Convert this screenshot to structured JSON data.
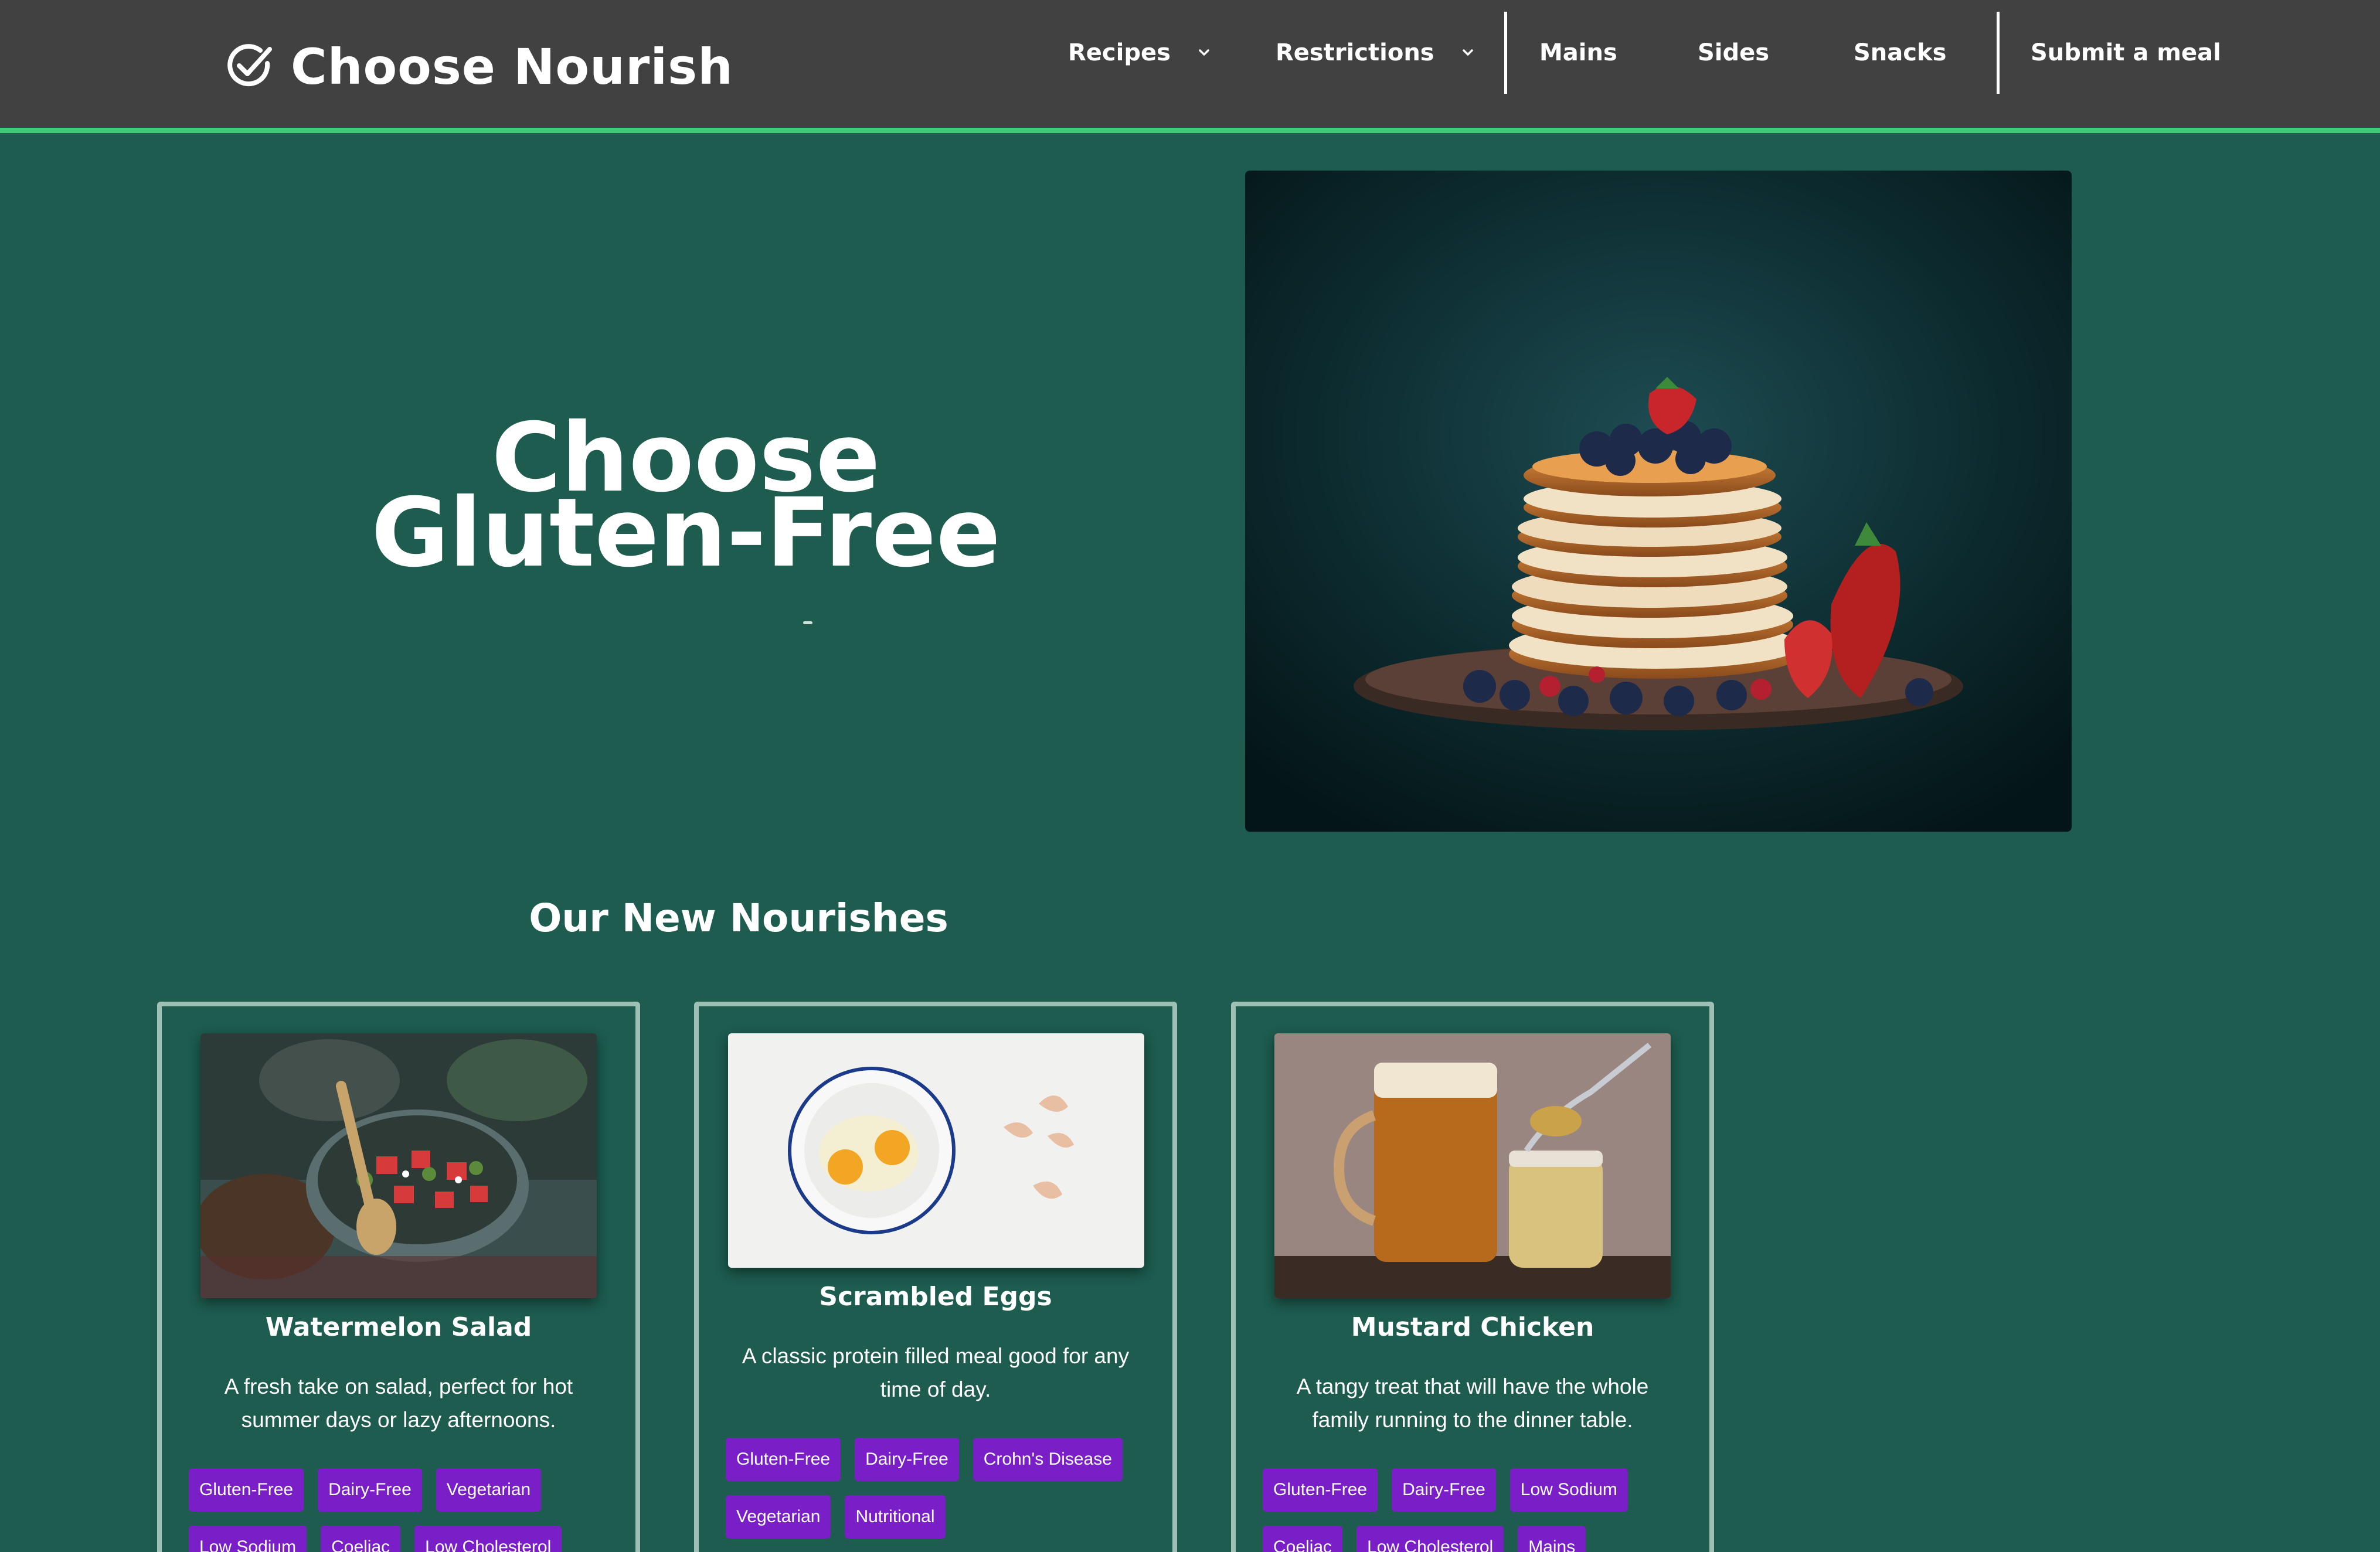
{
  "brand": {
    "name": "Choose Nourish",
    "icon": "check-circle-icon"
  },
  "nav": {
    "recipes": "Recipes",
    "restrictions": "Restrictions",
    "mains": "Mains",
    "sides": "Sides",
    "snacks": "Snacks",
    "submit": "Submit a meal"
  },
  "hero": {
    "title_line1": "Choose",
    "title_line2": "Gluten-Free",
    "image": "pancake-stack-photo"
  },
  "section": {
    "title": "Our New Nourishes"
  },
  "cards": [
    {
      "title": "Watermelon Salad",
      "description": "A fresh take on salad, perfect for hot summer days or lazy afternoons.",
      "image": "watermelon-salad-photo",
      "tags": [
        "Gluten-Free",
        "Dairy-Free",
        "Vegetarian",
        "Low Sodium",
        "Coeliac",
        "Low Cholesterol"
      ]
    },
    {
      "title": "Scrambled Eggs",
      "description": "A classic protein filled meal good for any time of day.",
      "image": "eggs-in-bowl-photo",
      "tags": [
        "Gluten-Free",
        "Dairy-Free",
        "Crohn's Disease",
        "Vegetarian",
        "Nutritional"
      ]
    },
    {
      "title": "Mustard Chicken",
      "description": "A tangy treat that will have the whole family running to the dinner table.",
      "image": "mustard-jar-photo",
      "tags": [
        "Gluten-Free",
        "Dairy-Free",
        "Low Sodium",
        "Coeliac",
        "Low Cholesterol",
        "Mains"
      ]
    }
  ],
  "colors": {
    "nav_bg": "#414141",
    "nav_accent": "#3fc979",
    "page_bg": "#1d5c4f",
    "tag_bg": "#7a1fc8",
    "card_border": "#9ebfb4"
  }
}
